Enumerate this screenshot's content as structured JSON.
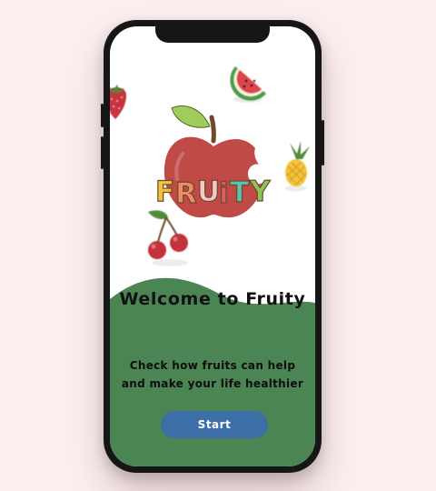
{
  "welcome": {
    "title": "Welcome to Fruity",
    "description_line1": "Check how fruits can help",
    "description_line2": "and make your life healthier"
  },
  "start_button": {
    "label": "Start"
  },
  "logo": {
    "text_letters": [
      "F",
      "R",
      "U",
      "i",
      "T",
      "Y"
    ]
  },
  "colors": {
    "background": "#fbeeee",
    "wave_green": "#4b8553",
    "button_blue": "#3c6ea8",
    "apple_red": "#c04a46",
    "leaf_green": "#9fcc5a"
  },
  "icons": [
    "apple-logo-icon",
    "watermelon-icon",
    "strawberry-icon",
    "pineapple-icon",
    "cherry-icon"
  ]
}
